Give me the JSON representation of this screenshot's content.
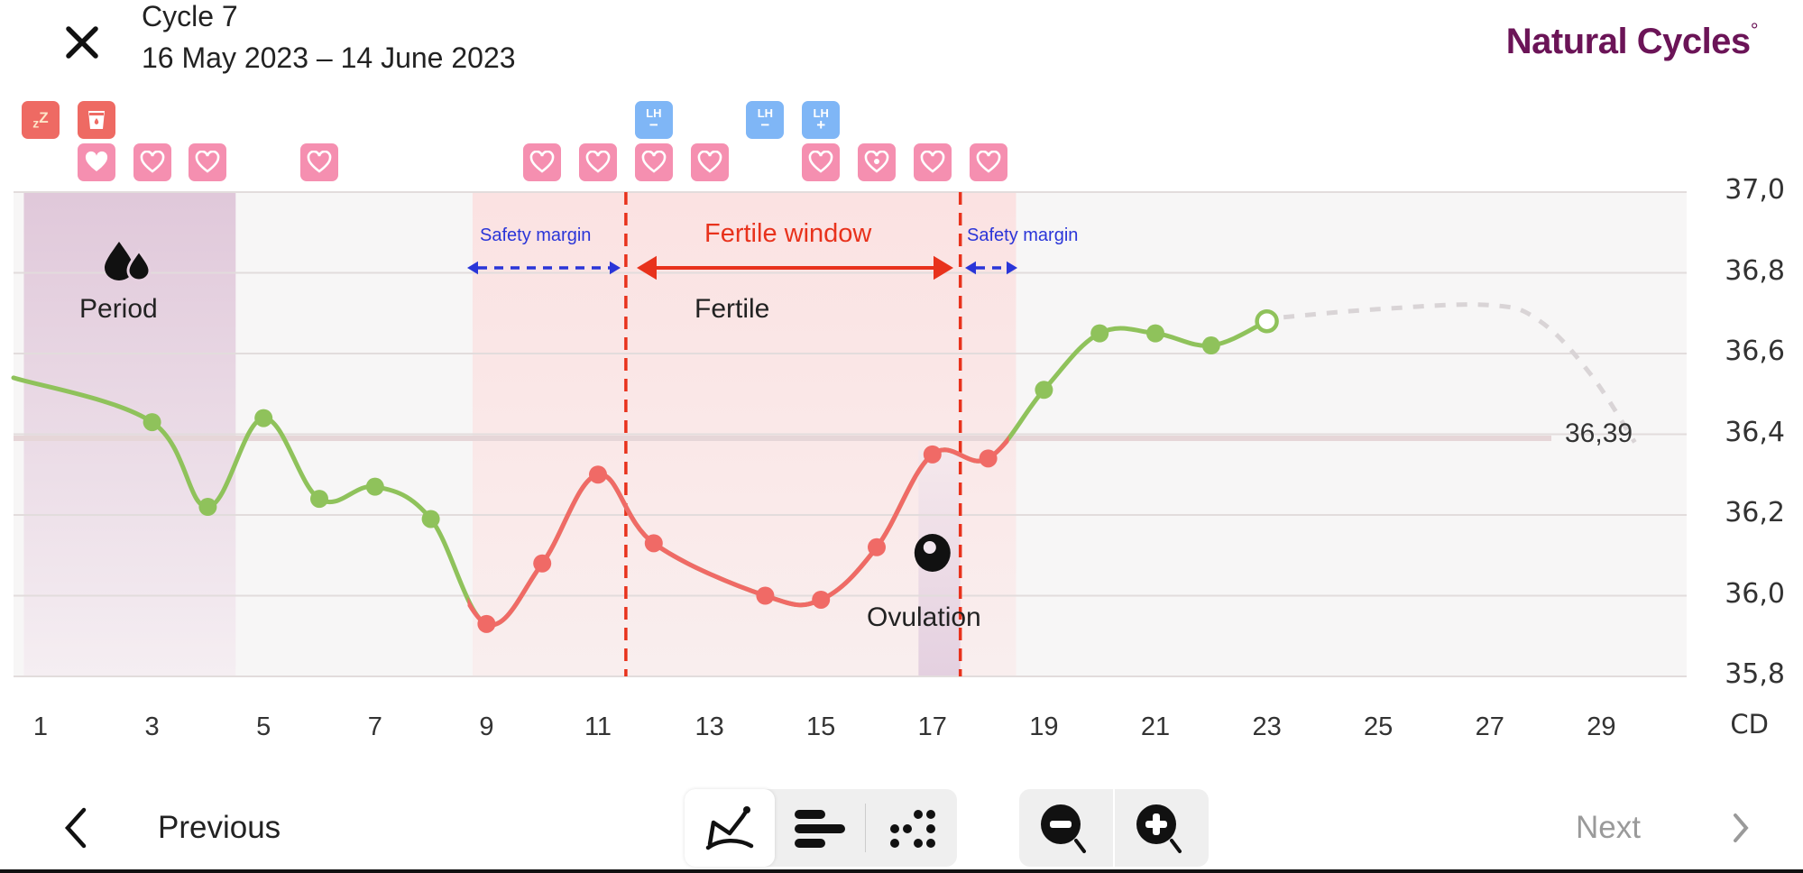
{
  "header": {
    "cycle_title": "Cycle 7",
    "cycle_dates": "16 May 2023 – 14 June 2023",
    "brand_name": "Natural Cycles",
    "brand_mark": "°"
  },
  "top_badges": {
    "row1": [
      {
        "day": 1,
        "type": "sleep-icon",
        "label": "zZ",
        "color": "#ee6a63"
      },
      {
        "day": 2,
        "type": "cup-icon",
        "label": "",
        "color": "#ee6a63"
      },
      {
        "day": 12,
        "type": "lh-negative-icon",
        "label": "LH",
        "sign": "−",
        "color": "#7fb6f6"
      },
      {
        "day": 14,
        "type": "lh-negative-icon",
        "label": "LH",
        "sign": "−",
        "color": "#7fb6f6"
      },
      {
        "day": 15,
        "type": "lh-positive-icon",
        "label": "LH",
        "sign": "+",
        "color": "#7fb6f6"
      }
    ],
    "row2": [
      {
        "day": 2,
        "type": "heart-filled-icon"
      },
      {
        "day": 3,
        "type": "heart-outline-icon"
      },
      {
        "day": 4,
        "type": "heart-outline-icon"
      },
      {
        "day": 6,
        "type": "heart-outline-icon"
      },
      {
        "day": 10,
        "type": "heart-outline-icon"
      },
      {
        "day": 11,
        "type": "heart-outline-icon"
      },
      {
        "day": 12,
        "type": "heart-outline-icon"
      },
      {
        "day": 13,
        "type": "heart-outline-icon"
      },
      {
        "day": 15,
        "type": "heart-outline-icon"
      },
      {
        "day": 16,
        "type": "heart-protected-icon"
      },
      {
        "day": 17,
        "type": "heart-outline-icon"
      },
      {
        "day": 18,
        "type": "heart-outline-icon"
      }
    ]
  },
  "annotations": {
    "period_label": "Period",
    "fertile_label": "Fertile",
    "ovulation_label": "Ovulation",
    "fertile_window_label": "Fertile window",
    "safety_margin_left_label": "Safety margin",
    "safety_margin_right_label": "Safety margin",
    "cover_line_label": "36,39"
  },
  "chart_data": {
    "type": "line",
    "title": "",
    "xlabel": "CD",
    "ylabel": "",
    "xlim": [
      0.7,
      30.7
    ],
    "ylim": [
      35.8,
      37.0
    ],
    "x_ticks": [
      "1",
      "3",
      "5",
      "7",
      "9",
      "11",
      "13",
      "15",
      "17",
      "19",
      "21",
      "23",
      "25",
      "27",
      "29"
    ],
    "y_ticks": [
      "37,0",
      "36,8",
      "36,6",
      "36,4",
      "36,2",
      "36,0",
      "35,8"
    ],
    "y_tick_values": [
      37.0,
      36.8,
      36.6,
      36.4,
      36.2,
      36.0,
      35.8
    ],
    "grid": true,
    "cover_line": 36.39,
    "regions": [
      {
        "name": "period",
        "from": 0.7,
        "to": 4.5,
        "color": "#e3cadc"
      },
      {
        "name": "safety-margin-left",
        "from": 8.75,
        "to": 11.5,
        "color": "#fbe3e3"
      },
      {
        "name": "fertile",
        "from": 11.5,
        "to": 17.5,
        "color": "#fce4e4"
      },
      {
        "name": "safety-margin-right",
        "from": 17.5,
        "to": 18.5,
        "color": "#fbe3e3"
      },
      {
        "name": "ovulation",
        "from": 16.75,
        "to": 17.5,
        "color": "#e6d3e2"
      }
    ],
    "fertile_window_bounds": [
      11.5,
      17.5
    ],
    "ovulation_day": 17,
    "series": [
      {
        "name": "temperature",
        "points": [
          {
            "x": 0.7,
            "y": 36.54,
            "marker": false,
            "status": "green"
          },
          {
            "x": 3,
            "y": 36.43,
            "status": "green"
          },
          {
            "x": 4,
            "y": 36.22,
            "status": "green"
          },
          {
            "x": 5,
            "y": 36.44,
            "status": "green"
          },
          {
            "x": 6,
            "y": 36.24,
            "status": "green"
          },
          {
            "x": 7,
            "y": 36.27,
            "status": "green"
          },
          {
            "x": 8,
            "y": 36.19,
            "status": "green"
          },
          {
            "x": 9,
            "y": 35.93,
            "status": "red"
          },
          {
            "x": 10,
            "y": 36.08,
            "status": "red"
          },
          {
            "x": 11,
            "y": 36.3,
            "status": "red"
          },
          {
            "x": 12,
            "y": 36.13,
            "status": "red"
          },
          {
            "x": 14,
            "y": 36.0,
            "status": "red"
          },
          {
            "x": 15,
            "y": 35.99,
            "status": "red"
          },
          {
            "x": 16,
            "y": 36.12,
            "status": "red"
          },
          {
            "x": 17,
            "y": 36.35,
            "status": "red"
          },
          {
            "x": 18,
            "y": 36.34,
            "status": "red"
          },
          {
            "x": 19,
            "y": 36.51,
            "status": "green"
          },
          {
            "x": 20,
            "y": 36.65,
            "status": "green"
          },
          {
            "x": 21,
            "y": 36.65,
            "status": "green"
          },
          {
            "x": 22,
            "y": 36.62,
            "status": "green"
          },
          {
            "x": 23,
            "y": 36.68,
            "status": "green",
            "open": true
          }
        ]
      },
      {
        "name": "prediction",
        "dashed": true,
        "points": [
          {
            "x": 23.3,
            "y": 36.69
          },
          {
            "x": 25,
            "y": 36.71
          },
          {
            "x": 27,
            "y": 36.72
          },
          {
            "x": 27.9,
            "y": 36.68
          },
          {
            "x": 28.8,
            "y": 36.55
          },
          {
            "x": 29.6,
            "y": 36.38
          }
        ]
      }
    ],
    "colors": {
      "green": "#8fc25b",
      "red": "#f06a66",
      "prediction": "#d9d4d6",
      "fertile_line": "#e8321c",
      "safety_arrow": "#2a35d8"
    }
  },
  "footer": {
    "previous_label": "Previous",
    "next_label": "Next",
    "view_modes": [
      {
        "name": "graph-view",
        "active": true
      },
      {
        "name": "list-view",
        "active": false
      },
      {
        "name": "dots-view",
        "active": false
      }
    ],
    "zoom_out_label": "zoom-out",
    "zoom_in_label": "zoom-in"
  }
}
